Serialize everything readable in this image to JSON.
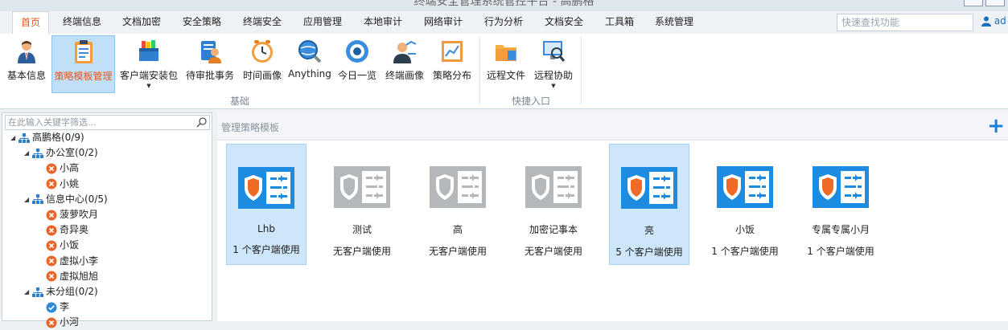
{
  "window": {
    "title": "终端安全管理系统管控平台 - 高鹏格"
  },
  "menu": {
    "tabs": [
      {
        "label": "首页"
      },
      {
        "label": "终端信息"
      },
      {
        "label": "文档加密"
      },
      {
        "label": "安全策略"
      },
      {
        "label": "终端安全"
      },
      {
        "label": "应用管理"
      },
      {
        "label": "本地审计"
      },
      {
        "label": "网络审计"
      },
      {
        "label": "行为分析"
      },
      {
        "label": "文档安全"
      },
      {
        "label": "工具箱"
      },
      {
        "label": "系统管理"
      }
    ],
    "active_tab": "首页",
    "search_placeholder": "快速查找功能",
    "user_label": "ad"
  },
  "ribbon": {
    "buttons": [
      {
        "label": "基本信息",
        "icon": "user-info-icon"
      },
      {
        "label": "策略模板管理",
        "icon": "template-clipboard-icon"
      },
      {
        "label": "客户端安装包",
        "icon": "install-package-icon"
      },
      {
        "label": "待审批事务",
        "icon": "approval-icon"
      },
      {
        "label": "时间画像",
        "icon": "clock-icon"
      },
      {
        "label": "Anything",
        "icon": "search-globe-icon"
      },
      {
        "label": "今日一览",
        "icon": "eye-icon"
      },
      {
        "label": "终端画像",
        "icon": "terminal-profile-icon"
      },
      {
        "label": "策略分布",
        "icon": "chart-icon"
      },
      {
        "label": "远程文件",
        "icon": "remote-file-icon"
      },
      {
        "label": "远程协助",
        "icon": "remote-assist-icon"
      }
    ],
    "groups": [
      {
        "label": "基础"
      },
      {
        "label": "快捷入口"
      }
    ]
  },
  "tree": {
    "filter_placeholder": "在此输入关键字筛选...",
    "nodes": [
      {
        "label": "高鹏格(0/9)",
        "type": "group"
      },
      {
        "label": "办公室(0/2)",
        "type": "group"
      },
      {
        "label": "小高",
        "type": "offline"
      },
      {
        "label": "小姚",
        "type": "offline"
      },
      {
        "label": "信息中心(0/5)",
        "type": "group"
      },
      {
        "label": "菠萝吹月",
        "type": "offline"
      },
      {
        "label": "奇异奥",
        "type": "offline"
      },
      {
        "label": "小饭",
        "type": "offline"
      },
      {
        "label": "虚拟小李",
        "type": "offline"
      },
      {
        "label": "虚拟旭旭",
        "type": "offline"
      },
      {
        "label": "未分组(0/2)",
        "type": "group"
      },
      {
        "label": "李",
        "type": "online"
      },
      {
        "label": "小河",
        "type": "offline"
      }
    ]
  },
  "main": {
    "header": "管理策略模板",
    "templates": [
      {
        "name": "Lhb",
        "usage": "1 个客户端使用",
        "state": "active"
      },
      {
        "name": "测试",
        "usage": "无客户端使用",
        "state": "inactive"
      },
      {
        "name": "高",
        "usage": "无客户端使用",
        "state": "inactive"
      },
      {
        "name": "加密记事本",
        "usage": "无客户端使用",
        "state": "inactive"
      },
      {
        "name": "亮",
        "usage": "5 个客户端使用",
        "state": "active"
      },
      {
        "name": "小饭",
        "usage": "1 个客户端使用",
        "state": "active"
      },
      {
        "name": "专属专属小月",
        "usage": "1 个客户端使用",
        "state": "active"
      }
    ]
  },
  "colors": {
    "accent": "#e8561e",
    "brand_blue": "#1a80d9",
    "selected_bg": "#cde6fa",
    "inactive_gray": "#b5b8bb"
  }
}
